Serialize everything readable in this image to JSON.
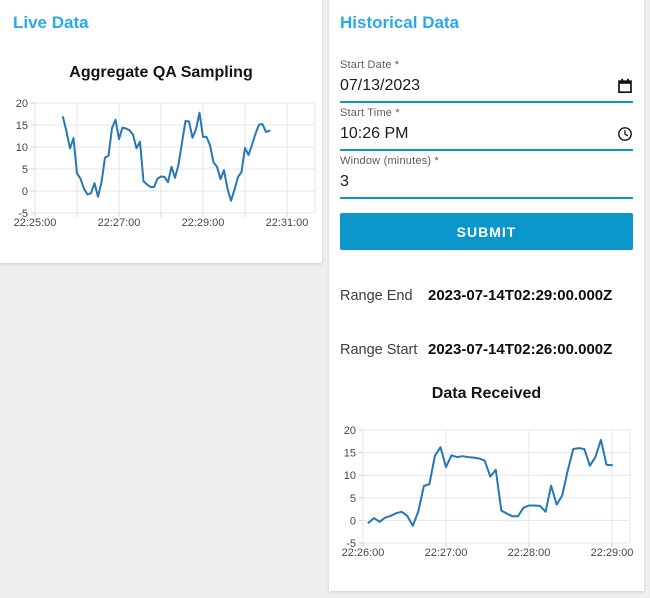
{
  "colors": {
    "heading_blue": "#29a9ea",
    "accent_blue": "#0b97cb",
    "line_blue": "#2577b5",
    "page_background": "#efefef"
  },
  "left_panel": {
    "heading": "Live Data"
  },
  "right_panel": {
    "heading": "Historical Data",
    "fields": [
      {
        "label": "Start Date *",
        "value": "07/13/2023",
        "icon": "calendar-icon"
      },
      {
        "label": "Start Time *",
        "value": "10:26 PM",
        "icon": "clock-icon"
      },
      {
        "label": "Window (minutes) *",
        "value": "3",
        "icon": ""
      }
    ],
    "submit_label": "SUBMIT",
    "range_end": {
      "label": "Range End",
      "value": "2023-07-14T02:29:00.000Z"
    },
    "range_start": {
      "label": "Range Start",
      "value": "2023-07-14T02:26:00.000Z"
    }
  },
  "chart_data": [
    {
      "type": "line",
      "title": "Aggregate QA Sampling",
      "xlabel": "",
      "ylabel": "",
      "y_ticks": [
        -5,
        0,
        5,
        10,
        15,
        20
      ],
      "ylim": [
        -5,
        20
      ],
      "x_axis_start": "22:25:00",
      "x_axis_end": "22:31:00",
      "x_ticks": [
        {
          "sec": 0,
          "label": "22:25:00"
        },
        {
          "sec": 120,
          "label": "22:27:00"
        },
        {
          "sec": 240,
          "label": "22:29:00"
        },
        {
          "sec": 360,
          "label": "22:31:00"
        }
      ],
      "x_gridlines_sec": [
        0,
        60,
        120,
        180,
        240,
        300,
        360
      ],
      "grid": true,
      "legend": false,
      "series_start_sec": 40,
      "series_step_sec": 5,
      "values": [
        16.8,
        13.5,
        9.7,
        12.0,
        4.0,
        2.8,
        0.5,
        -0.8,
        -0.5,
        1.8,
        -1.3,
        2.0,
        7.6,
        8.0,
        14.3,
        16.2,
        11.8,
        14.4,
        14.2,
        13.8,
        12.8,
        9.7,
        11.2,
        2.2,
        1.5,
        0.9,
        0.9,
        2.8,
        3.3,
        3.2,
        2.0,
        5.5,
        3.0,
        6.0,
        11.0,
        15.9,
        15.8,
        12.1,
        14.0,
        17.8,
        12.3,
        12.3,
        10.4,
        6.5,
        5.5,
        2.7,
        4.7,
        0.5,
        -2.2,
        0.3,
        3.2,
        4.3,
        9.8,
        8.2,
        10.5,
        13.0,
        15.1,
        15.2,
        13.4,
        13.7
      ]
    },
    {
      "type": "line",
      "title": "Data Received",
      "xlabel": "",
      "ylabel": "",
      "y_ticks": [
        -5,
        0,
        5,
        10,
        15,
        20
      ],
      "ylim": [
        -5,
        20
      ],
      "x_axis_start": "22:26:00",
      "x_axis_end": "22:29:00",
      "x_ticks": [
        {
          "sec": 0,
          "label": "22:26:00"
        },
        {
          "sec": 60,
          "label": "22:27:00"
        },
        {
          "sec": 120,
          "label": "22:28:00"
        },
        {
          "sec": 180,
          "label": "22:29:00"
        }
      ],
      "x_gridlines_sec": [
        0,
        60,
        120,
        180
      ],
      "grid": true,
      "legend": false,
      "series_start_sec": 4,
      "series_step_sec": 4,
      "values": [
        -0.5,
        0.5,
        -0.3,
        0.6,
        1.0,
        1.6,
        1.9,
        1.0,
        -1.2,
        2.0,
        7.6,
        8.0,
        14.3,
        16.2,
        11.8,
        14.4,
        14.0,
        14.2,
        14.0,
        13.9,
        13.7,
        13.2,
        9.7,
        11.2,
        2.2,
        1.5,
        0.9,
        0.9,
        2.8,
        3.3,
        3.3,
        3.2,
        1.9,
        7.7,
        3.5,
        5.5,
        11.0,
        15.8,
        16.0,
        15.8,
        12.1,
        14.0,
        17.8,
        12.3,
        12.2
      ]
    }
  ]
}
